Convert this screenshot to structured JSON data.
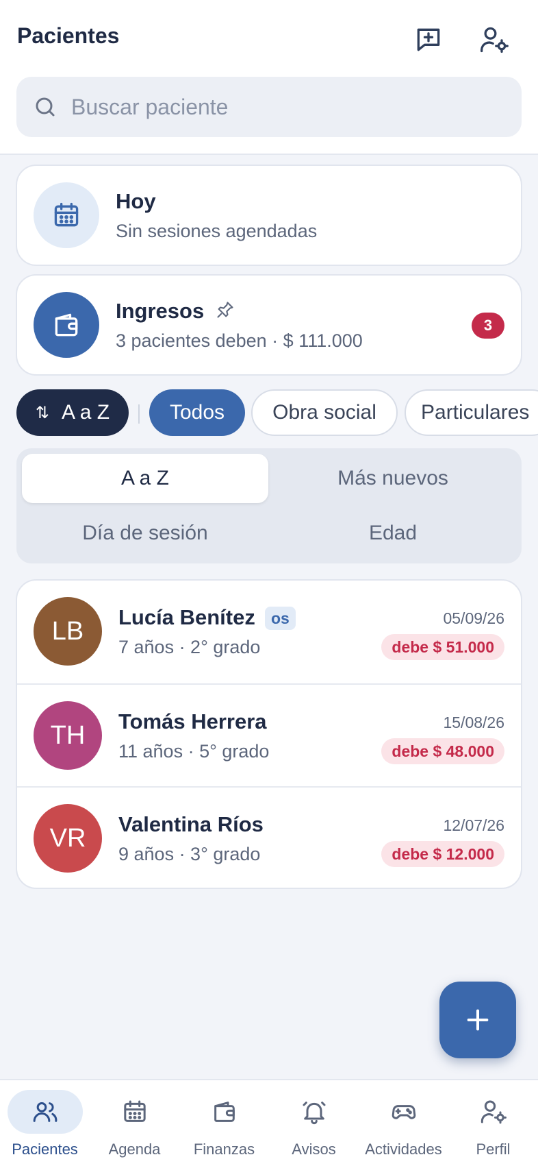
{
  "header": {
    "title": "Pacientes",
    "new_message_icon": "message-plus-icon",
    "settings_icon": "user-gear-icon"
  },
  "search": {
    "placeholder": "Buscar paciente",
    "value": ""
  },
  "today_card": {
    "icon": "calendar-icon",
    "title": "Hoy",
    "subtitle": "Sin sesiones agendadas"
  },
  "income_card": {
    "icon": "wallet-icon",
    "pin_icon": "pin-icon",
    "title": "Ingresos",
    "subtitle": "3 pacientes deben · $ 111.000",
    "badge": "3"
  },
  "filters": {
    "sort_chip": "A a Z",
    "chips": [
      {
        "label": "Todos",
        "active": true
      },
      {
        "label": "Obra social",
        "active": false
      },
      {
        "label": "Particulares",
        "active": false
      }
    ]
  },
  "sort_options": [
    {
      "label": "A a Z",
      "selected": true
    },
    {
      "label": "Más nuevos",
      "selected": false
    },
    {
      "label": "Día de sesión",
      "selected": false
    },
    {
      "label": "Edad",
      "selected": false
    }
  ],
  "patients": [
    {
      "initials": "LB",
      "name": "Lucía Benítez",
      "tag": "os",
      "meta": "7 años · 2° grado",
      "date": "05/09/26",
      "debt": "debe $ 51.000",
      "color": "#8b5a34"
    },
    {
      "initials": "TH",
      "name": "Tomás Herrera",
      "tag": "",
      "meta": "11 años · 5° grado",
      "date": "15/08/26",
      "debt": "debe $ 48.000",
      "color": "#b1457f"
    },
    {
      "initials": "VR",
      "name": "Valentina Ríos",
      "tag": "",
      "meta": "9 años · 3° grado",
      "date": "12/07/26",
      "debt": "debe $ 12.000",
      "color": "#c94a4d"
    }
  ],
  "fab": {
    "icon": "plus-icon"
  },
  "nav": [
    {
      "label": "Pacientes",
      "icon": "users-icon",
      "active": true
    },
    {
      "label": "Agenda",
      "icon": "calendar-icon",
      "active": false
    },
    {
      "label": "Finanzas",
      "icon": "wallet-icon",
      "active": false
    },
    {
      "label": "Avisos",
      "icon": "bell-icon",
      "active": false
    },
    {
      "label": "Actividades",
      "icon": "gamepad-icon",
      "active": false
    },
    {
      "label": "Perfil",
      "icon": "user-gear-icon",
      "active": false
    }
  ],
  "colors": {
    "primary": "#3b68ac",
    "dark": "#1f2b47",
    "danger": "#c42a4a",
    "danger_bg": "#fbe3e7"
  }
}
